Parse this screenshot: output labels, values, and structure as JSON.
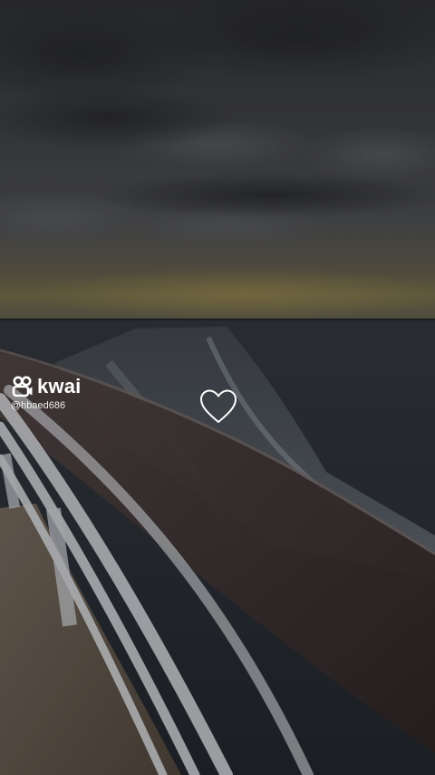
{
  "watermark": {
    "brand": "kwai",
    "handle": "@hbaed686",
    "logo_icon": "kwai-logo-icon"
  },
  "like": {
    "icon": "heart-outline-icon"
  },
  "colors": {
    "text": "#ffffff",
    "sky_dark": "#2b2c30",
    "horizon_glow": "#6b6444",
    "sea": "#2b2f35",
    "railing": "#3a2f2e",
    "railing_white": "#c9ccd0",
    "deck": "#5a5045"
  }
}
